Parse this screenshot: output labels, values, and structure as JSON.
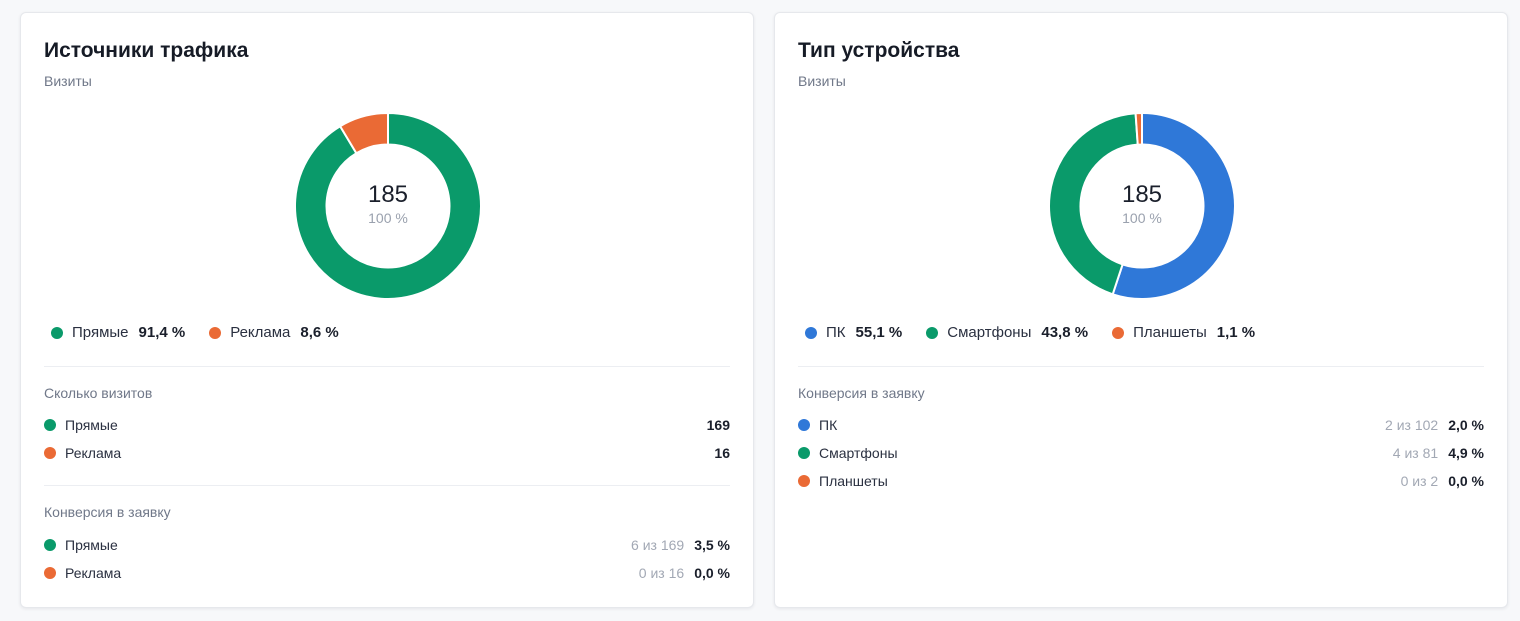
{
  "colors": {
    "green": "#0a9a6a",
    "orange": "#ea6a35",
    "blue": "#2f78d8"
  },
  "cards": [
    {
      "title": "Источники трафика",
      "subtitle": "Визиты",
      "donut": {
        "total": "185",
        "percent": "100 %",
        "segments": [
          {
            "name": "Прямые",
            "share": 91.4,
            "color": "#0a9a6a"
          },
          {
            "name": "Реклама",
            "share": 8.6,
            "color": "#ea6a35"
          }
        ]
      },
      "legend": [
        {
          "label": "Прямые",
          "value": "91,4 %",
          "color": "#0a9a6a"
        },
        {
          "label": "Реклама",
          "value": "8,6 %",
          "color": "#ea6a35"
        }
      ],
      "visits_section": {
        "title": "Сколько визитов",
        "rows": [
          {
            "label": "Прямые",
            "value": "169",
            "color": "#0a9a6a"
          },
          {
            "label": "Реклама",
            "value": "16",
            "color": "#ea6a35"
          }
        ]
      },
      "conversion_section": {
        "title": "Конверсия в заявку",
        "rows": [
          {
            "label": "Прямые",
            "fraction": "6 из 169",
            "value": "3,5 %",
            "color": "#0a9a6a"
          },
          {
            "label": "Реклама",
            "fraction": "0 из 16",
            "value": "0,0 %",
            "color": "#ea6a35"
          }
        ]
      }
    },
    {
      "title": "Тип устройства",
      "subtitle": "Визиты",
      "donut": {
        "total": "185",
        "percent": "100 %",
        "segments": [
          {
            "name": "ПК",
            "share": 55.1,
            "color": "#2f78d8"
          },
          {
            "name": "Смартфоны",
            "share": 43.8,
            "color": "#0a9a6a"
          },
          {
            "name": "Планшеты",
            "share": 1.1,
            "color": "#ea6a35"
          }
        ]
      },
      "legend": [
        {
          "label": "ПК",
          "value": "55,1 %",
          "color": "#2f78d8"
        },
        {
          "label": "Смартфоны",
          "value": "43,8 %",
          "color": "#0a9a6a"
        },
        {
          "label": "Планшеты",
          "value": "1,1 %",
          "color": "#ea6a35"
        }
      ],
      "conversion_section": {
        "title": "Конверсия в заявку",
        "rows": [
          {
            "label": "ПК",
            "fraction": "2 из 102",
            "value": "2,0 %",
            "color": "#2f78d8"
          },
          {
            "label": "Смартфоны",
            "fraction": "4 из 81",
            "value": "4,9 %",
            "color": "#0a9a6a"
          },
          {
            "label": "Планшеты",
            "fraction": "0 из 2",
            "value": "0,0 %",
            "color": "#ea6a35"
          }
        ]
      }
    }
  ]
}
